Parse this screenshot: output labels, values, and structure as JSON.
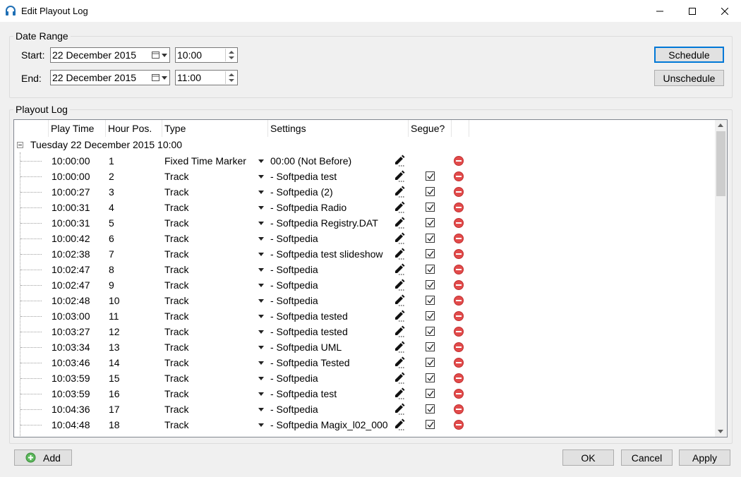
{
  "window": {
    "title": "Edit Playout Log"
  },
  "date_range": {
    "label": "Date Range",
    "start_label": "Start:",
    "start_date": "22 December 2015",
    "start_time": "10:00",
    "end_label": "End:",
    "end_date": "22 December 2015",
    "end_time": "11:00",
    "schedule_label": "Schedule",
    "unschedule_label": "Unschedule"
  },
  "playout_log": {
    "label": "Playout Log",
    "columns": [
      "Play Time",
      "Hour Pos.",
      "Type",
      "Settings",
      "Segue?"
    ],
    "group_header": "Tuesday 22 December 2015 10:00",
    "rows": [
      {
        "time": "10:00:00",
        "pos": "1",
        "type": "Fixed Time Marker",
        "settings": "00:00 (Not Before)",
        "segue": false
      },
      {
        "time": "10:00:00",
        "pos": "2",
        "type": "Track",
        "settings": "- Softpedia test",
        "segue": true
      },
      {
        "time": "10:00:27",
        "pos": "3",
        "type": "Track",
        "settings": "- Softpedia (2)",
        "segue": true
      },
      {
        "time": "10:00:31",
        "pos": "4",
        "type": "Track",
        "settings": "- Softpedia Radio",
        "segue": true
      },
      {
        "time": "10:00:31",
        "pos": "5",
        "type": "Track",
        "settings": "- Softpedia Registry.DAT",
        "segue": true
      },
      {
        "time": "10:00:42",
        "pos": "6",
        "type": "Track",
        "settings": "- Softpedia",
        "segue": true
      },
      {
        "time": "10:02:38",
        "pos": "7",
        "type": "Track",
        "settings": "- Softpedia test slideshow",
        "segue": true
      },
      {
        "time": "10:02:47",
        "pos": "8",
        "type": "Track",
        "settings": "- Softpedia",
        "segue": true
      },
      {
        "time": "10:02:47",
        "pos": "9",
        "type": "Track",
        "settings": "- Softpedia",
        "segue": true
      },
      {
        "time": "10:02:48",
        "pos": "10",
        "type": "Track",
        "settings": "- Softpedia",
        "segue": true
      },
      {
        "time": "10:03:00",
        "pos": "11",
        "type": "Track",
        "settings": "- Softpedia tested",
        "segue": true
      },
      {
        "time": "10:03:27",
        "pos": "12",
        "type": "Track",
        "settings": "- Softpedia tested",
        "segue": true
      },
      {
        "time": "10:03:34",
        "pos": "13",
        "type": "Track",
        "settings": "- Softpedia UML",
        "segue": true
      },
      {
        "time": "10:03:46",
        "pos": "14",
        "type": "Track",
        "settings": "- Softpedia Tested",
        "segue": true
      },
      {
        "time": "10:03:59",
        "pos": "15",
        "type": "Track",
        "settings": "- Softpedia",
        "segue": true
      },
      {
        "time": "10:03:59",
        "pos": "16",
        "type": "Track",
        "settings": "- Softpedia test",
        "segue": true
      },
      {
        "time": "10:04:36",
        "pos": "17",
        "type": "Track",
        "settings": "- Softpedia",
        "segue": true
      },
      {
        "time": "10:04:48",
        "pos": "18",
        "type": "Track",
        "settings": "- Softpedia Magix_l02_000",
        "segue": true
      }
    ]
  },
  "footer": {
    "add_label": "Add",
    "ok_label": "OK",
    "cancel_label": "Cancel",
    "apply_label": "Apply"
  },
  "colors": {
    "accent": "#0078d7",
    "delete": "#e24b4b",
    "add": "#4caf50"
  }
}
